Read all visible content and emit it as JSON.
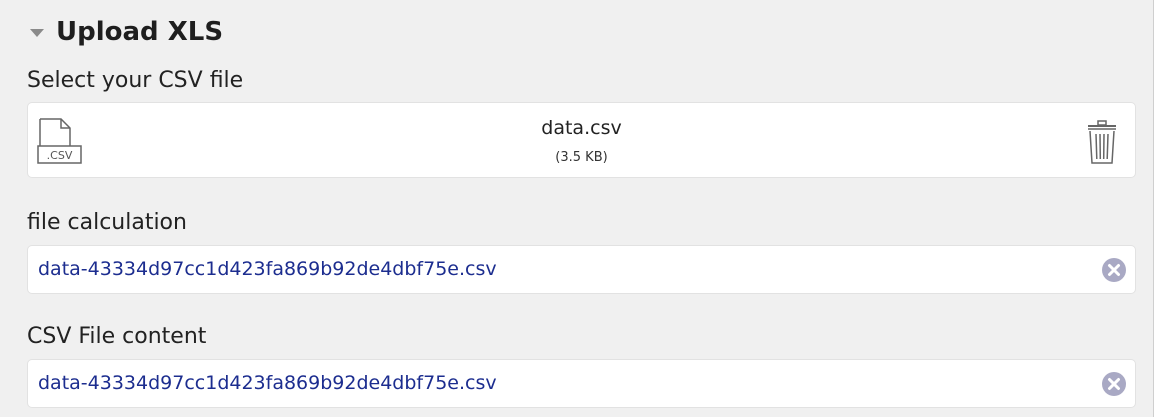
{
  "section": {
    "title": "Upload XLS",
    "expanded": true
  },
  "file_upload": {
    "label": "Select your CSV file",
    "file_name": "data.csv",
    "file_size": "(3.5 KB)",
    "file_icon_text": ".CSV",
    "icon": "csv-file-icon",
    "delete_icon": "trash-icon"
  },
  "file_calculation": {
    "label": "file calculation",
    "value": "data-43334d97cc1d423fa869b92de4dbf75e.csv",
    "clear_icon": "clear-circle-icon"
  },
  "csv_content": {
    "label": "CSV File content",
    "value": "data-43334d97cc1d423fa869b92de4dbf75e.csv",
    "clear_icon": "clear-circle-icon"
  },
  "colors": {
    "background": "#f0f0f0",
    "value_text": "#1c2d8f",
    "clear_icon": "#a9a9c4",
    "icon_stroke": "#666666"
  }
}
